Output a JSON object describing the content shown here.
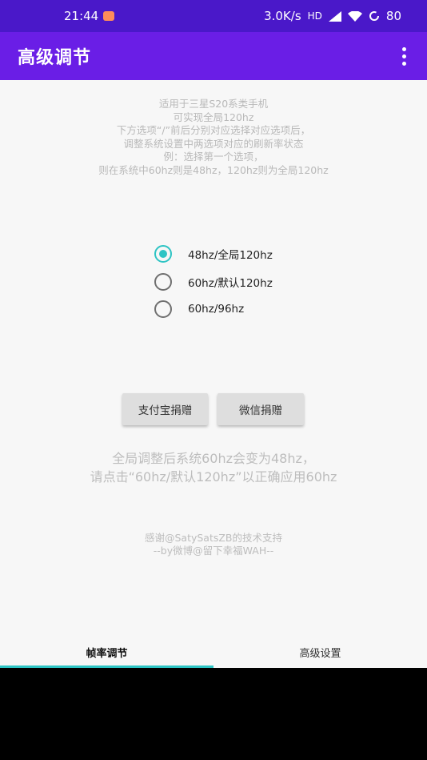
{
  "status_bar": {
    "time": "21:44",
    "speed": "3.0K/s",
    "hd": "HD",
    "battery": "80"
  },
  "app_bar": {
    "title": "高级调节"
  },
  "info_lines": [
    "适用于三星S20系类手机",
    "可实现全局120hz",
    "下方选项“/”前后分别对应选择对应选项后，",
    "调整系统设置中两选项对应的刷新率状态",
    "例：选择第一个选项，",
    "则在系统中60hz则是48hz，120hz则为全局120hz"
  ],
  "options": [
    {
      "label": "48hz/全局120hz",
      "checked": true
    },
    {
      "label": "60hz/默认120hz",
      "checked": false
    },
    {
      "label": "60hz/96hz",
      "checked": false
    }
  ],
  "buttons": {
    "alipay": "支付宝捐赠",
    "wechat": "微信捐赠"
  },
  "notice_lines": [
    "全局调整后系统60hz会变为48hz，",
    "请点击“60hz/默认120hz”以正确应用60hz"
  ],
  "credits_lines": [
    "感谢@SatySatsZB的技术支持",
    "--by微博@留下幸福WAH--"
  ],
  "tabs": [
    {
      "label": "帧率调节",
      "active": true
    },
    {
      "label": "高级设置",
      "active": false
    }
  ],
  "colors": {
    "status_bar": "#4a18c9",
    "app_bar": "#6a1ee6",
    "accent": "#2ec4c4"
  }
}
